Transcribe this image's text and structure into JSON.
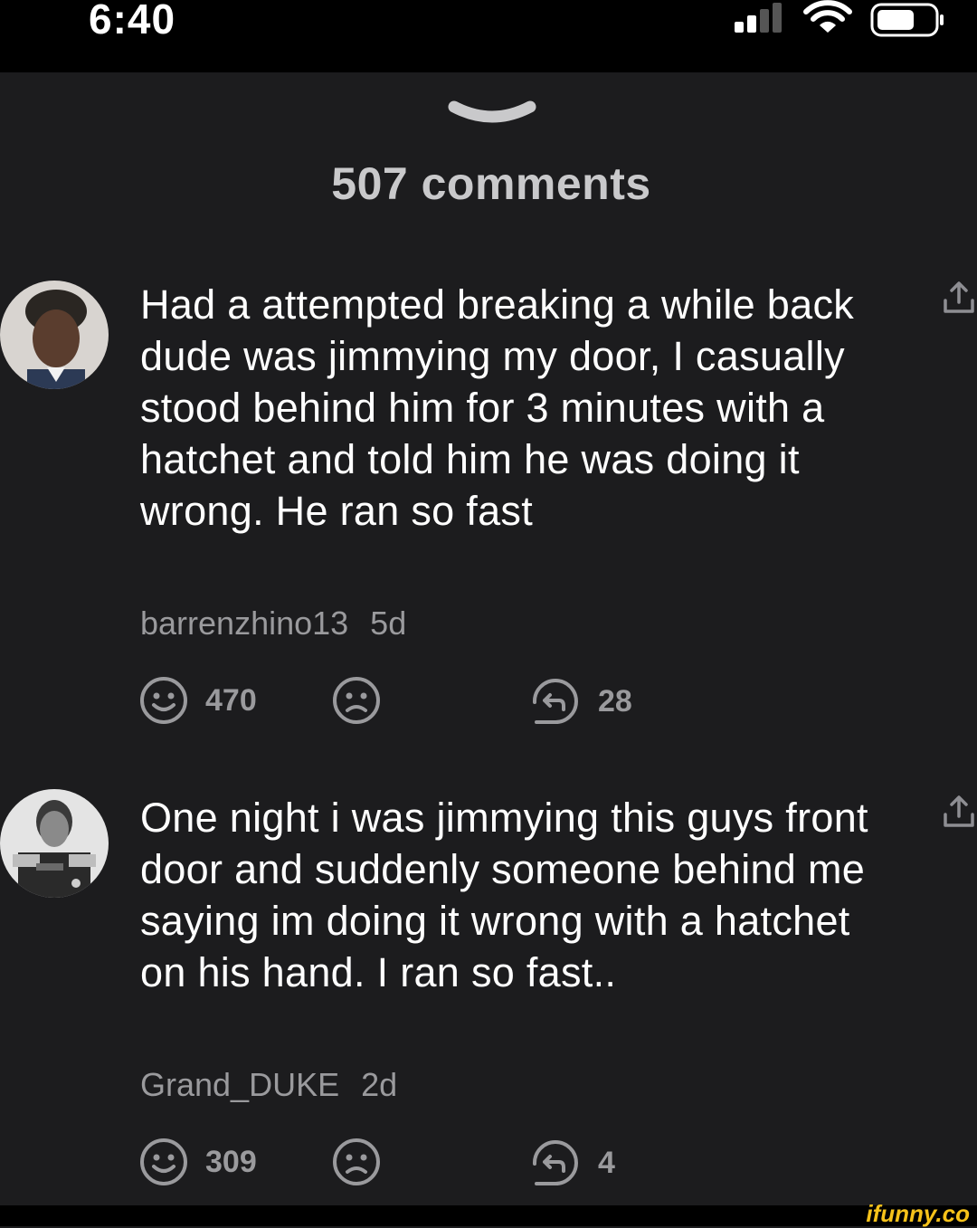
{
  "status_bar": {
    "time": "6:40"
  },
  "sheet": {
    "title": "507 comments"
  },
  "comments": [
    {
      "text": "Had a attempted breaking a while back dude was jimmying my door, I casually stood behind him for 3 minutes with a hatchet and told him he was doing it wrong. He ran so fast",
      "username": "barrenzhino13",
      "age": "5d",
      "smile_count": "470",
      "replies_count": "28"
    },
    {
      "text": "One night i was jimmying this guys front door and suddenly someone behind me saying im doing it wrong with a hatchet on his hand. I ran so fast..",
      "username": "Grand_DUKE",
      "age": "2d",
      "smile_count": "309",
      "replies_count": "4"
    }
  ],
  "watermark": "ifunny.co",
  "icons": [
    "signal-icon",
    "wifi-icon",
    "battery-icon",
    "chevron-down-icon",
    "share-icon",
    "smile-icon",
    "frown-icon",
    "reply-icon"
  ],
  "colors": {
    "background": "#1c1c1e",
    "text": "#ffffff",
    "muted": "#9a9a9d",
    "watermark": "#f6c21a"
  }
}
